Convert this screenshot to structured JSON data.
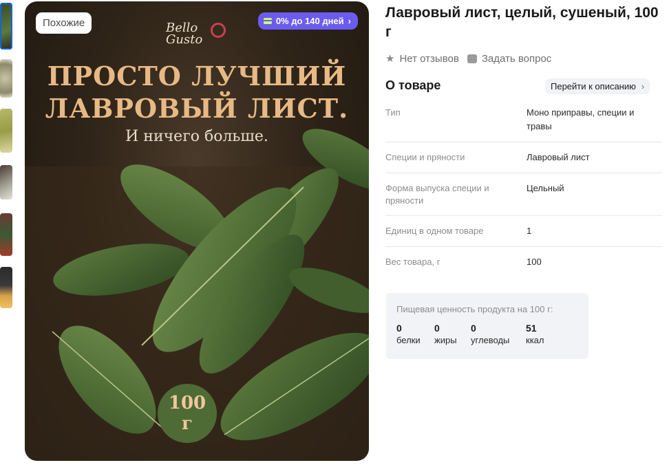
{
  "gallery": {
    "similar_label": "Похожие",
    "installment_label": "0% до 140 дней",
    "brand_line1": "Bello",
    "brand_line2": "Gusto",
    "headline_line1": "ПРОСТО ЛУЧШИЙ",
    "headline_line2": "ЛАВРОВЫЙ ЛИСТ.",
    "tagline": "И ничего больше.",
    "weight_number": "100",
    "weight_unit": "г"
  },
  "product": {
    "title": "Лавровый лист, целый, сушеный, 100 г",
    "reviews_label": "Нет отзывов",
    "ask_label": "Задать вопрос",
    "about_title": "О товаре",
    "to_description_label": "Перейти к описанию"
  },
  "specs": [
    {
      "key": "Тип",
      "value": "Моно приправы, специи и травы"
    },
    {
      "key": "Специи и пряности",
      "value": "Лавровый лист"
    },
    {
      "key": "Форма выпуска специи и пряности",
      "value": "Цельный"
    },
    {
      "key": "Единиц в одном товаре",
      "value": "1"
    },
    {
      "key": "Вес товара, г",
      "value": "100"
    }
  ],
  "nutrition": {
    "caption": "Пищевая ценность продукта на 100 г:",
    "items": [
      {
        "value": "0",
        "label": "белки"
      },
      {
        "value": "0",
        "label": "жиры"
      },
      {
        "value": "0",
        "label": "углеводы"
      },
      {
        "value": "51",
        "label": "ккал"
      }
    ]
  }
}
